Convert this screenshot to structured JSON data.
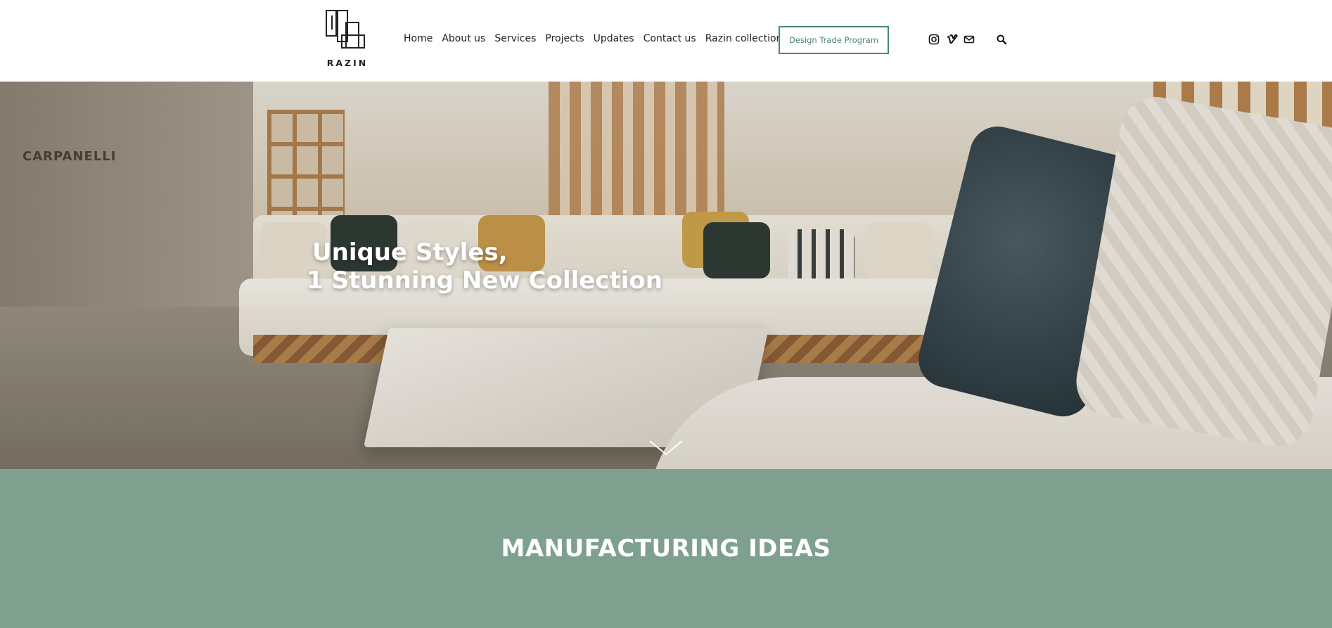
{
  "brand": {
    "logo_text": "RAZIN"
  },
  "nav": {
    "items": [
      {
        "label": "Home"
      },
      {
        "label": "About us"
      },
      {
        "label": "Services"
      },
      {
        "label": "Projects"
      },
      {
        "label": "Updates"
      },
      {
        "label": "Contact us"
      },
      {
        "label": "Razin collection"
      }
    ],
    "cta_label": "Design Trade Program"
  },
  "social_icons": [
    "instagram-icon",
    "vimeo-icon",
    "mail-icon",
    "search-icon"
  ],
  "hero": {
    "title_line1": "Unique Styles,",
    "title_line2": "1 Stunning New Collection",
    "wall_sign": "CARPANELLI"
  },
  "section": {
    "title": "MANUFACTURING IDEAS"
  },
  "colors": {
    "accent": "#4c8a67",
    "section_bg": "#7fa08f",
    "text": "#222222"
  }
}
